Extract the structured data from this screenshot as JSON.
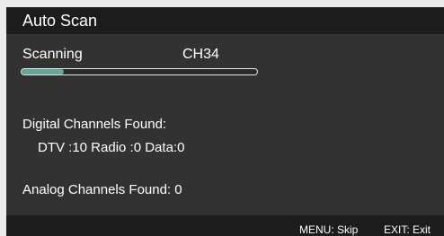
{
  "window": {
    "title": "Auto Scan"
  },
  "scan": {
    "status_label": "Scanning",
    "current_channel": "CH34",
    "progress": 0.18
  },
  "digital": {
    "heading": "Digital Channels Found:",
    "counts_line": "DTV :10  Radio :0  Data:0"
  },
  "analog": {
    "line": "Analog Channels Found: 0"
  },
  "footer": {
    "menu_hint": "MENU: Skip",
    "exit_hint": "EXIT: Exit"
  },
  "colors": {
    "progress_fill": "#5fa89a",
    "panel": "#323232",
    "bar": "#1c1c1c"
  }
}
